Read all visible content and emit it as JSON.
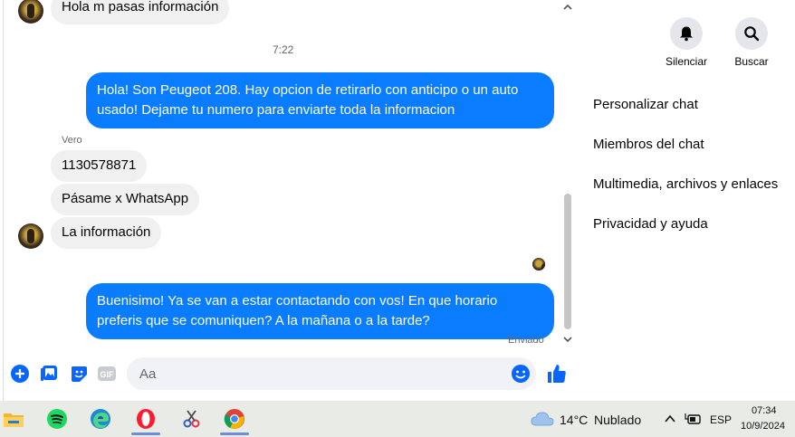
{
  "chat": {
    "top_message": "Hola m pasas información",
    "timestamp": "7:22",
    "outgoing_1": "Hola! Son Peugeot 208. Hay opcion de retirarlo con anticipo o un auto usado! Dejame tu numero para enviarte toda la informacion",
    "sender_name": "Vero",
    "incoming": [
      "1130578871",
      "Pásame x WhatsApp",
      "La información"
    ],
    "outgoing_2": "Buenisimo! Ya se van a estar contactando con vos! En que horario preferis que se comuniquen? A la mañana o a la tarde?",
    "status": "Enviado"
  },
  "composer": {
    "placeholder": "Aa",
    "gif_label": "GIF"
  },
  "panel": {
    "mute_label": "Silenciar",
    "search_label": "Buscar",
    "menu": [
      "Personalizar chat",
      "Miembros del chat",
      "Multimedia, archivos y enlaces",
      "Privacidad y ayuda"
    ]
  },
  "taskbar": {
    "temperature": "14°C",
    "weather": "Nublado",
    "language": "ESP",
    "time": "07:34",
    "date": "10/9/2024"
  },
  "colors": {
    "outgoing_bubble": "#0a7cff",
    "incoming_bubble": "#f0f0f0",
    "accent": "#0866ff"
  }
}
